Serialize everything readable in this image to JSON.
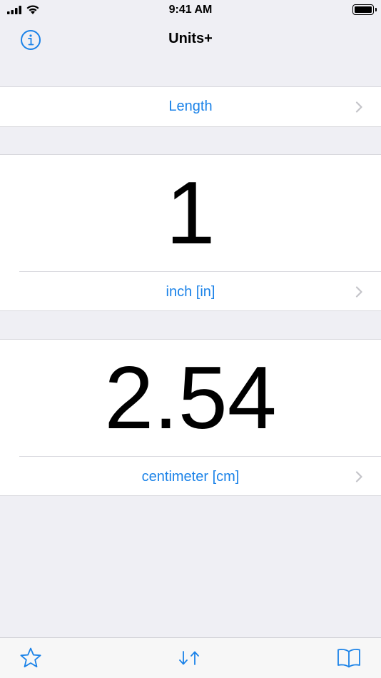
{
  "status_bar": {
    "time": "9:41 AM"
  },
  "nav": {
    "title": "Units+",
    "info_icon": "info-circle-icon"
  },
  "category": {
    "label": "Length"
  },
  "input": {
    "value": "1",
    "unit_label": "inch [in]"
  },
  "output": {
    "value": "2.54",
    "unit_label": "centimeter [cm]"
  },
  "tab_bar": {
    "icons": [
      "star-icon",
      "swap-arrows-icon",
      "book-icon"
    ]
  },
  "colors": {
    "accent": "#1a82e8",
    "background": "#efeff4",
    "separator": "#d9d9de",
    "chevron": "#c4c4c9"
  }
}
